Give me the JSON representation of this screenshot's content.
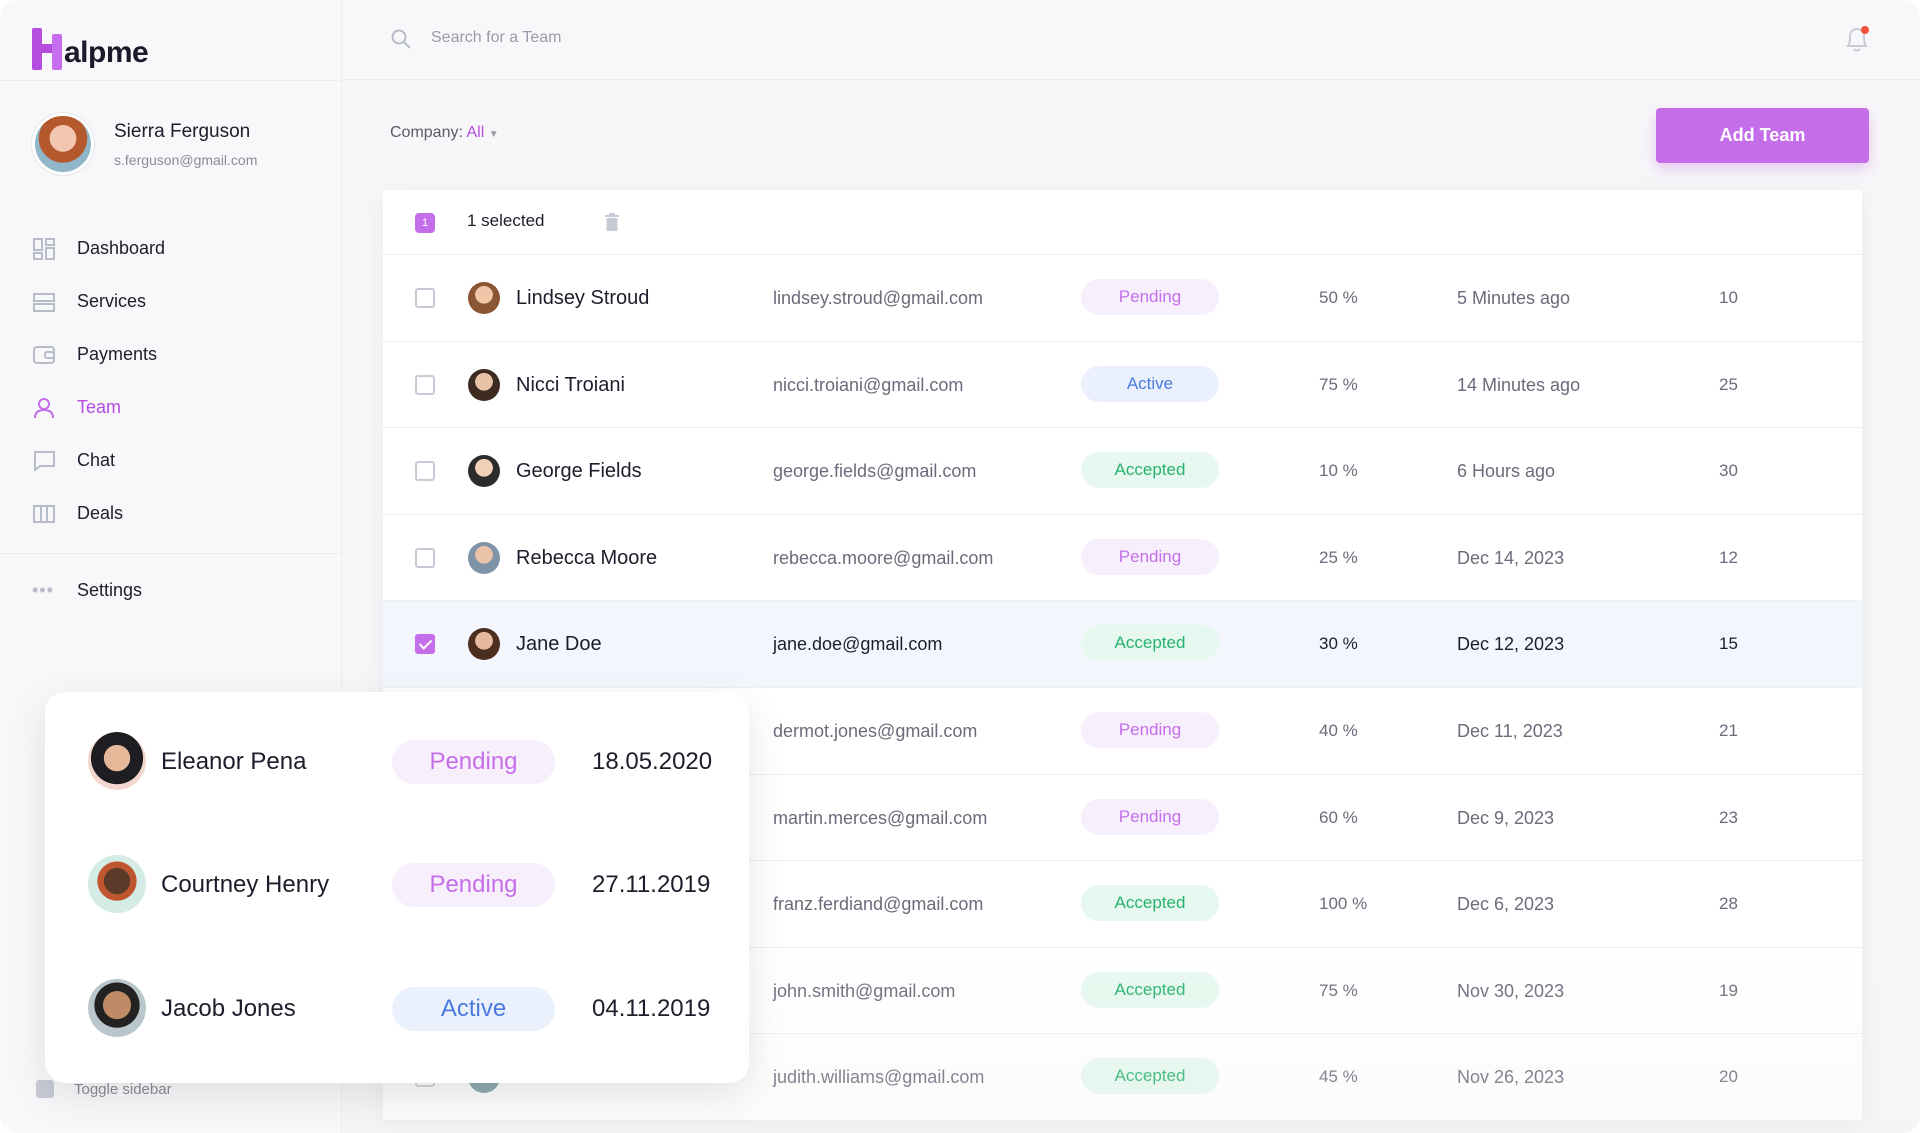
{
  "app": {
    "logo_text": "alpme",
    "brand_color": "#c56ee9"
  },
  "user": {
    "name": "Sierra Ferguson",
    "email": "s.ferguson@gmail.com"
  },
  "nav": [
    {
      "label": "Dashboard",
      "icon": "dashboard-icon"
    },
    {
      "label": "Services",
      "icon": "services-icon"
    },
    {
      "label": "Payments",
      "icon": "wallet-icon"
    },
    {
      "label": "Team",
      "icon": "person-icon",
      "active": true
    },
    {
      "label": "Chat",
      "icon": "chat-icon"
    },
    {
      "label": "Deals",
      "icon": "columns-icon"
    }
  ],
  "settings_label": "Settings",
  "toggle_sidebar_label": "Toggle sidebar",
  "search": {
    "placeholder": "Search for a Team"
  },
  "filter": {
    "label": "Company:",
    "value": "All"
  },
  "add_team_label": "Add Team",
  "table": {
    "selected_count": "1",
    "selected_text": "1 selected",
    "rows": [
      {
        "name": "Lindsey Stroud",
        "email": "lindsey.stroud@gmail.com",
        "status": "Pending",
        "pct": "50 %",
        "time": "5 Minutes ago",
        "num": "10",
        "checked": false
      },
      {
        "name": "Nicci Troiani",
        "email": "nicci.troiani@gmail.com",
        "status": "Active",
        "pct": "75 %",
        "time": "14 Minutes ago",
        "num": "25",
        "checked": false
      },
      {
        "name": "George Fields",
        "email": "george.fields@gmail.com",
        "status": "Accepted",
        "pct": "10 %",
        "time": "6 Hours ago",
        "num": "30",
        "checked": false
      },
      {
        "name": "Rebecca Moore",
        "email": "rebecca.moore@gmail.com",
        "status": "Pending",
        "pct": "25 %",
        "time": "Dec 14, 2023",
        "num": "12",
        "checked": false
      },
      {
        "name": "Jane Doe",
        "email": "jane.doe@gmail.com",
        "status": "Accepted",
        "pct": "30 %",
        "time": "Dec 12, 2023",
        "num": "15",
        "checked": true
      },
      {
        "name": "",
        "email": "dermot.jones@gmail.com",
        "status": "Pending",
        "pct": "40 %",
        "time": "Dec 11, 2023",
        "num": "21",
        "checked": false
      },
      {
        "name": "",
        "email": "martin.merces@gmail.com",
        "status": "Pending",
        "pct": "60 %",
        "time": "Dec 9, 2023",
        "num": "23",
        "checked": false
      },
      {
        "name": "",
        "email": "franz.ferdiand@gmail.com",
        "status": "Accepted",
        "pct": "100 %",
        "time": "Dec 6, 2023",
        "num": "28",
        "checked": false
      },
      {
        "name": "",
        "email": "john.smith@gmail.com",
        "status": "Accepted",
        "pct": "75 %",
        "time": "Nov 30, 2023",
        "num": "19",
        "checked": false
      },
      {
        "name": "",
        "email": "judith.williams@gmail.com",
        "status": "Accepted",
        "pct": "45 %",
        "time": "Nov 26, 2023",
        "num": "20",
        "checked": false
      }
    ]
  },
  "card": [
    {
      "name": "Eleanor Pena",
      "status": "Pending",
      "date": "18.05.2020"
    },
    {
      "name": "Courtney Henry",
      "status": "Pending",
      "date": "27.11.2019"
    },
    {
      "name": "Jacob Jones",
      "status": "Active",
      "date": "04.11.2019"
    }
  ]
}
